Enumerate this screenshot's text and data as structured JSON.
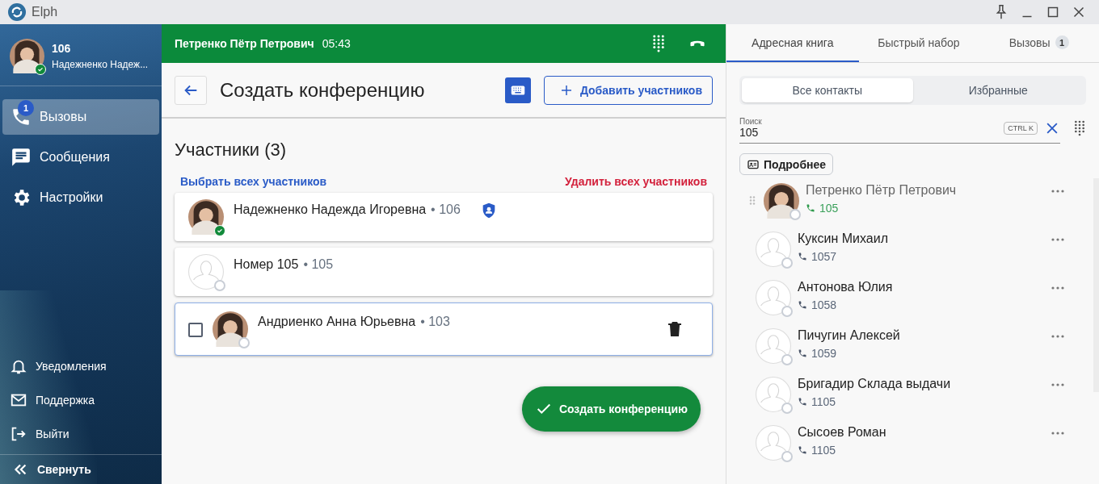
{
  "window": {
    "title": "Elph"
  },
  "user": {
    "number": "106",
    "name": "Надежненко Надеж...",
    "has_photo": true,
    "online": true
  },
  "nav": [
    {
      "label": "Вызовы",
      "badge": "1",
      "selected": true
    },
    {
      "label": "Сообщения",
      "selected": false
    },
    {
      "label": "Настройки",
      "selected": false
    }
  ],
  "nav_bottom": [
    {
      "label": "Уведомления"
    },
    {
      "label": "Поддержка"
    },
    {
      "label": "Выйти"
    }
  ],
  "collapse": {
    "label": "Свернуть"
  },
  "call_bar": {
    "name": "Петренко Пётр Петрович",
    "time": "05:43"
  },
  "header": {
    "title": "Создать конференцию",
    "add_button": "Добавить участников"
  },
  "participants": {
    "title": "Участники (3)",
    "select_all": "Выбрать всех участников",
    "remove_all": "Удалить всех участников",
    "items": [
      {
        "name": "Надежненко Надежда Игоревна",
        "number": "• 106",
        "has_photo": true,
        "online": true,
        "moderator": true,
        "hovered": false
      },
      {
        "name": "Номер 105",
        "number": "• 105",
        "has_photo": false,
        "online": false,
        "moderator": false,
        "hovered": false
      },
      {
        "name": "Андриенко Анна Юрьевна",
        "number": "• 103",
        "has_photo": true,
        "online": false,
        "moderator": false,
        "hovered": true,
        "checked": false
      }
    ]
  },
  "create_button": "Создать конференцию",
  "tabs": [
    {
      "label": "Адресная книга",
      "selected": true
    },
    {
      "label": "Быстрый набор",
      "selected": false
    },
    {
      "label": "Вызовы",
      "badge": "1",
      "selected": false
    }
  ],
  "segments": [
    {
      "label": "Все контакты",
      "selected": true
    },
    {
      "label": "Избранные",
      "selected": false
    }
  ],
  "search": {
    "label": "Поиск",
    "value": "105",
    "shortcut": "CTRL K"
  },
  "details_button": "Подробнее",
  "contacts": [
    {
      "name": "Петренко Пётр Петрович",
      "number": "105",
      "has_photo": true,
      "in_call": true
    },
    {
      "name": "Куксин Михаил",
      "number": "1057",
      "has_photo": false,
      "in_call": false
    },
    {
      "name": "Антонова Юлия",
      "number": "1058",
      "has_photo": false,
      "in_call": false
    },
    {
      "name": "Пичугин Алексей",
      "number": "1059",
      "has_photo": false,
      "in_call": false
    },
    {
      "name": "Бригадир Склада выдачи",
      "number": "1105",
      "has_photo": false,
      "in_call": false
    },
    {
      "name": "Сысоев Роман",
      "number": "1105",
      "has_photo": false,
      "in_call": false
    }
  ]
}
